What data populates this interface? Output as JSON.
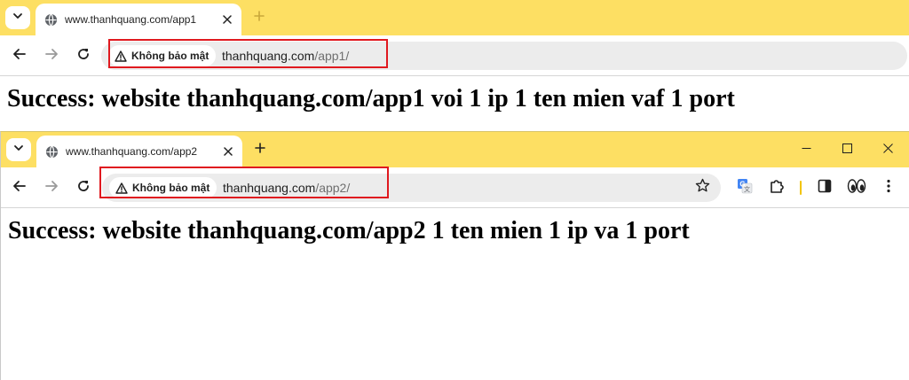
{
  "windows": [
    {
      "tab_title": "www.thanhquang.com/app1",
      "security_chip": "Không bảo mật",
      "url_host": "thanhquang.com",
      "url_path": "/app1/",
      "page_heading": "Success: website thanhquang.com/app1 voi 1 ip 1 ten mien vaf 1 port"
    },
    {
      "tab_title": "www.thanhquang.com/app2",
      "security_chip": "Không bảo mật",
      "url_host": "thanhquang.com",
      "url_path": "/app2/",
      "page_heading": "Success: website thanhquang.com/app2 1 ten mien 1 ip va 1 port"
    }
  ],
  "colors": {
    "tabstrip": "#fddf63",
    "omnibox": "#ececec",
    "highlight_box": "#e0191f"
  },
  "icons": {
    "tab_menu": "chevron-down-icon",
    "favicon": "globe-icon",
    "tab_close": "close-icon",
    "new_tab": "plus-icon",
    "back": "arrow-left-icon",
    "forward": "arrow-right-icon",
    "reload": "reload-icon",
    "security": "warning-triangle-icon",
    "bookmark": "star-icon",
    "translate": "translate-icon",
    "extensions": "puzzle-icon",
    "side_panel": "side-panel-icon",
    "profile": "eyes-icon",
    "menu": "kebab-menu-icon",
    "minimize": "minimize-icon",
    "maximize": "maximize-icon",
    "close_window": "close-window-icon"
  }
}
